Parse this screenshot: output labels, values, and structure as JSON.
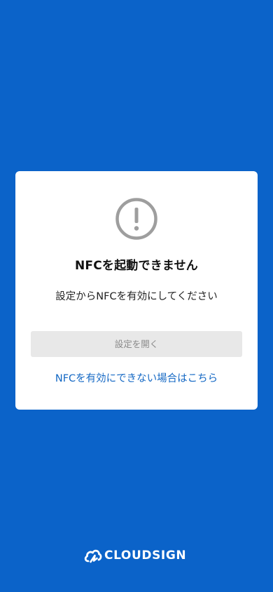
{
  "dialog": {
    "icon": "exclamation-circle-icon",
    "title": "NFCを起動できません",
    "message": "設定からNFCを有効にしてください",
    "button_label": "設定を開く",
    "help_link": "NFCを有効にできない場合はこちら"
  },
  "brand": {
    "icon": "cloudsign-logo-icon",
    "name": "CLOUDSIGN"
  },
  "colors": {
    "background": "#0b63c9",
    "link": "#1468c4",
    "button_bg": "#e8e8e8",
    "button_text": "#8a8a8a",
    "icon_gray": "#9e9e9e"
  }
}
